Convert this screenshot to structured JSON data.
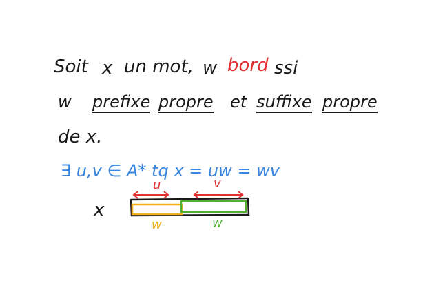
{
  "line1": {
    "soit": "Soit",
    "x": "x",
    "un_mot": "un mot,",
    "w": "w",
    "bord": "bord",
    "ssi": "ssi"
  },
  "line2": {
    "w": "w",
    "prefixe": "prefixe",
    "propre1": "propre",
    "et": "et",
    "suffixe": "suffixe",
    "propre2": "propre"
  },
  "line3": {
    "de_x": "de x."
  },
  "line4": {
    "formula": "∃ u,v ∈ A* tq x = uw = wv"
  },
  "diagram": {
    "x_label": "x",
    "u_label": "u",
    "v_label": "v",
    "w_left_label": "w",
    "w_right_label": "w"
  },
  "colors": {
    "ink": "#1a1a1a",
    "red": "#e03030",
    "blue": "#3a86e0",
    "orange": "#f0b020",
    "green": "#50b030"
  }
}
